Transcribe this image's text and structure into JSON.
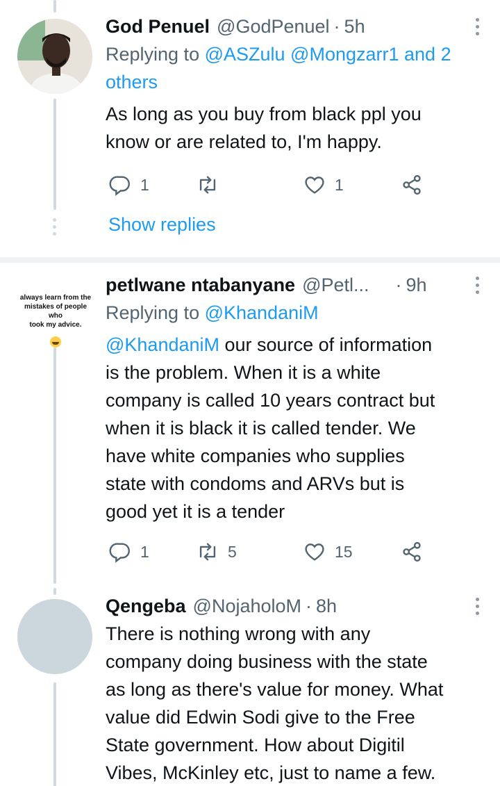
{
  "tweets": [
    {
      "name": "God Penuel",
      "handle": "@GodPenuel",
      "time": "5h",
      "replying_label": "Replying to",
      "replying_to": "@ASZulu @Mongzarr1 and 2 others",
      "body_lines": [
        "As long as you buy from black ppl you",
        "know or are related to, I'm happy."
      ],
      "replies": "1",
      "retweets": "",
      "likes": "1",
      "show_replies": "Show replies"
    },
    {
      "name": "petlwane ntabanyane",
      "handle": "@Petl...",
      "time": "9h",
      "replying_label": "Replying to",
      "replying_to": "@KhandaniM",
      "mention": "@KhandaniM",
      "body_lines": [
        " our source of information",
        "is the problem. When it is a  white",
        "company is called 10 years contract but",
        "when it is black it is called tender. We",
        "have white companies who supplies",
        "state with condoms and ARVs but is",
        "good yet it is a tender"
      ],
      "avatar_text": [
        "always learn from the",
        "mistakes of people who",
        "took my advice."
      ],
      "replies": "1",
      "retweets": "5",
      "likes": "15"
    },
    {
      "name": "Qengeba",
      "handle": "@NojaholoM",
      "time": "8h",
      "body_lines": [
        "There is nothing wrong with any",
        "company doing business with the state",
        "as long as there's value for money. What",
        "value did Edwin Sodi give to the Free",
        "State government. How about Digitil",
        "Vibes, McKinley etc, just to name a few."
      ]
    }
  ],
  "icons": {
    "reply": "reply-icon",
    "retweet": "retweet-icon",
    "like": "like-icon",
    "share": "share-icon",
    "more": "more-options-icon"
  },
  "colors": {
    "link": "#1d9bf0",
    "secondary_text": "#536471",
    "primary_text": "#0f1419",
    "thread_line": "#cfd9de"
  }
}
